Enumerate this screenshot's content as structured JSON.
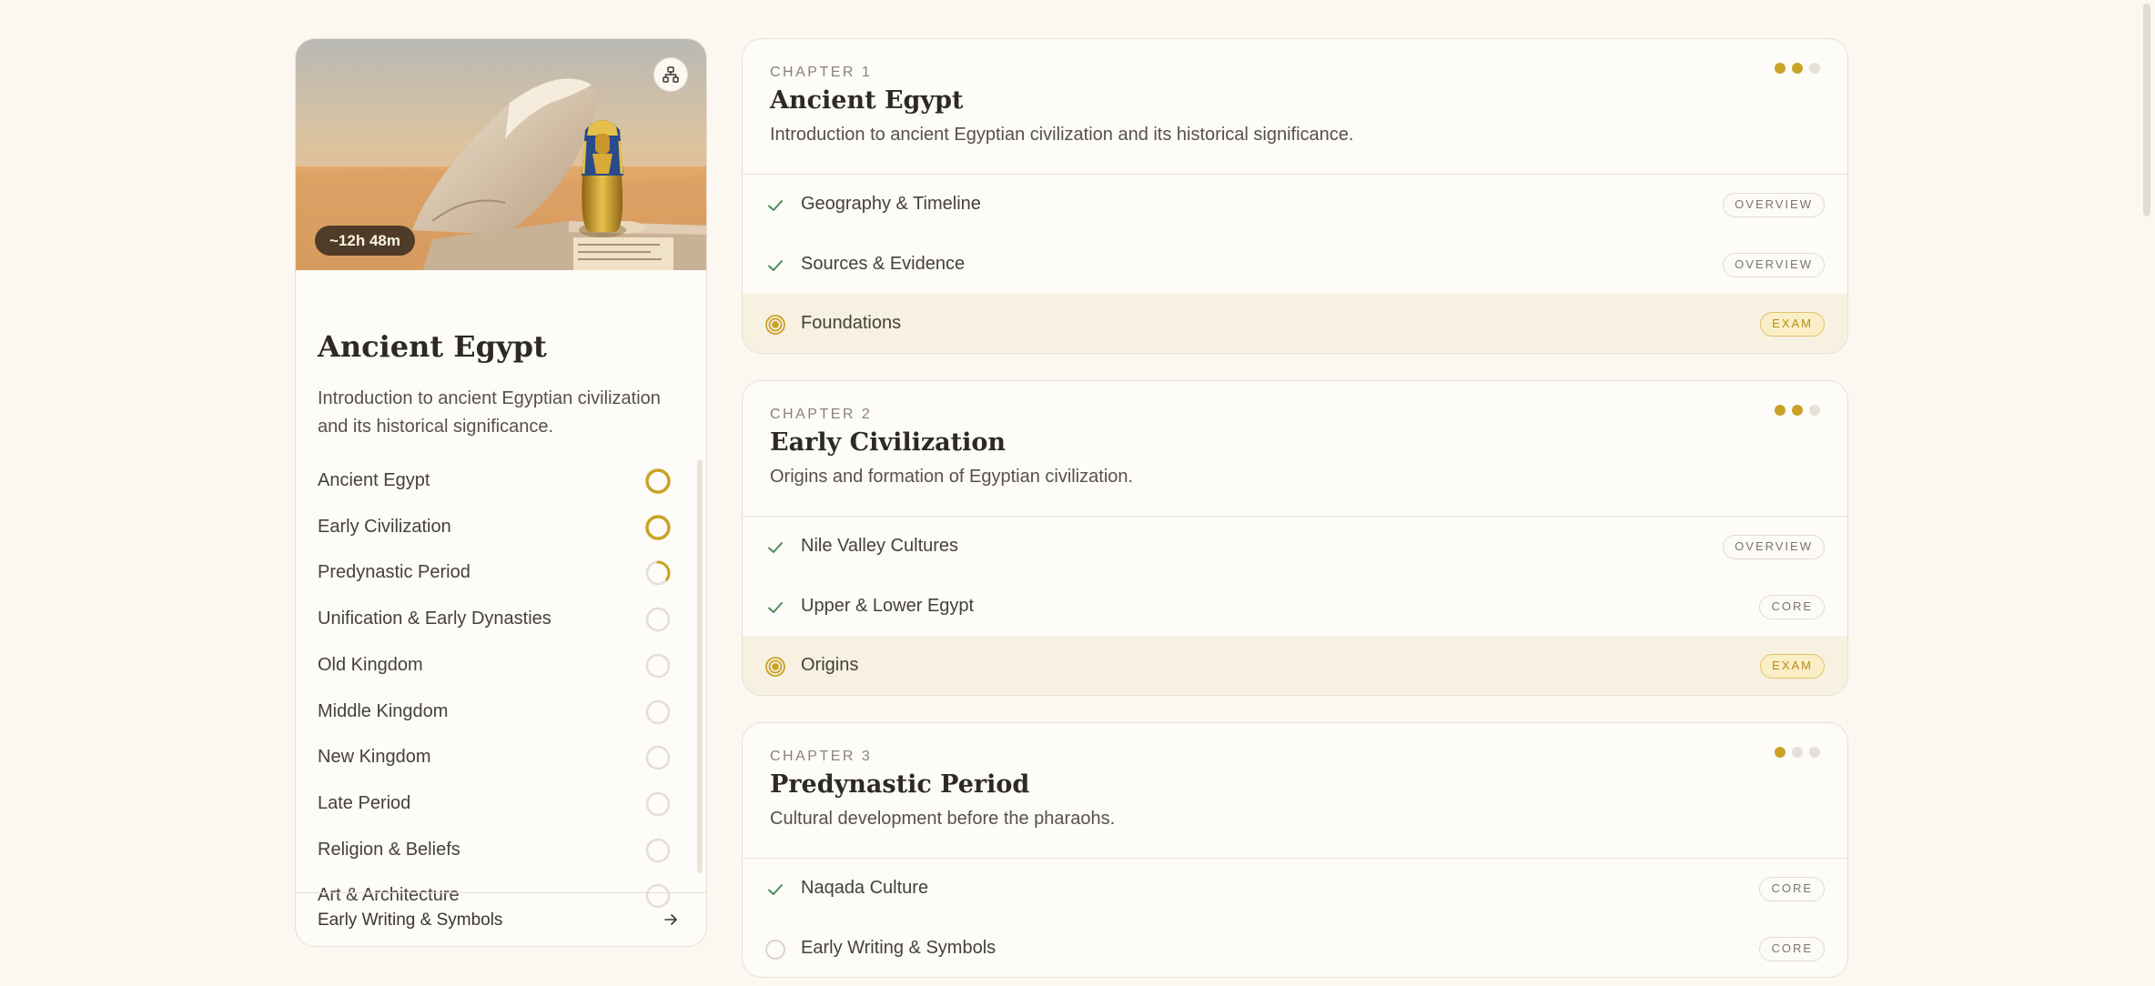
{
  "course": {
    "title": "Ancient Egypt",
    "description": "Introduction to ancient Egyptian civilization and its historical significance.",
    "duration": "~12h 48m",
    "share_icon": "share-nodes-icon",
    "chapters": [
      {
        "name": "Ancient Egypt",
        "progress": 1.0
      },
      {
        "name": "Early Civilization",
        "progress": 1.0
      },
      {
        "name": "Predynastic Period",
        "progress": 0.35
      },
      {
        "name": "Unification & Early Dynasties",
        "progress": 0
      },
      {
        "name": "Old Kingdom",
        "progress": 0
      },
      {
        "name": "Middle Kingdom",
        "progress": 0
      },
      {
        "name": "New Kingdom",
        "progress": 0
      },
      {
        "name": "Late Period",
        "progress": 0
      },
      {
        "name": "Religion & Beliefs",
        "progress": 0
      },
      {
        "name": "Art & Architecture",
        "progress": 0
      }
    ],
    "next_lesson": "Early Writing & Symbols"
  },
  "chapter_cards": [
    {
      "kicker": "CHAPTER 1",
      "title": "Ancient Egypt",
      "description": "Introduction to ancient Egyptian civilization and its historical significance.",
      "progress_dots": [
        true,
        true,
        false
      ],
      "lessons": [
        {
          "name": "Geography & Timeline",
          "status": "done",
          "tag": "OVERVIEW"
        },
        {
          "name": "Sources & Evidence",
          "status": "done",
          "tag": "OVERVIEW"
        },
        {
          "name": "Foundations",
          "status": "current",
          "tag": "EXAM"
        }
      ]
    },
    {
      "kicker": "CHAPTER 2",
      "title": "Early Civilization",
      "description": "Origins and formation of Egyptian civilization.",
      "progress_dots": [
        true,
        true,
        false
      ],
      "lessons": [
        {
          "name": "Nile Valley Cultures",
          "status": "done",
          "tag": "OVERVIEW"
        },
        {
          "name": "Upper & Lower Egypt",
          "status": "done",
          "tag": "CORE"
        },
        {
          "name": "Origins",
          "status": "current",
          "tag": "EXAM"
        }
      ]
    },
    {
      "kicker": "CHAPTER 3",
      "title": "Predynastic Period",
      "description": "Cultural development before the pharaohs.",
      "progress_dots": [
        true,
        false,
        false
      ],
      "lessons": [
        {
          "name": "Naqada Culture",
          "status": "done",
          "tag": "CORE"
        },
        {
          "name": "Early Writing & Symbols",
          "status": "todo",
          "tag": "CORE"
        }
      ]
    }
  ],
  "colors": {
    "accent": "#c9a227",
    "check": "#4f8a5b",
    "ring_empty": "#e4ded4"
  }
}
